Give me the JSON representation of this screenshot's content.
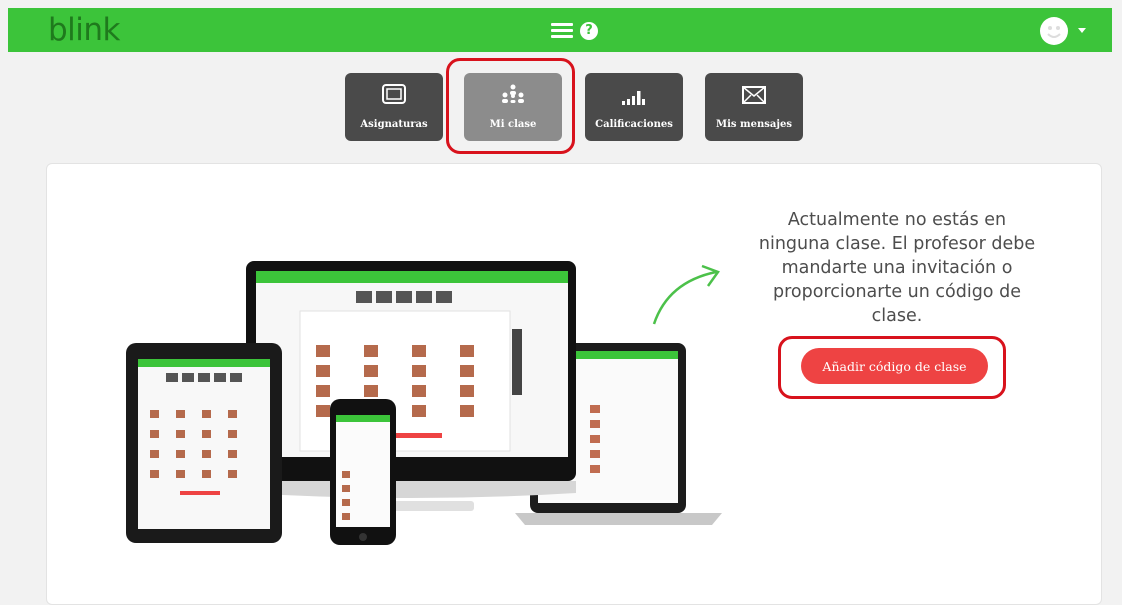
{
  "topbar": {
    "logo": "blink",
    "accent": "#3cc43a"
  },
  "nav": [
    {
      "label": "Asignaturas",
      "icon": "subjects-icon"
    },
    {
      "label": "Mi clase",
      "icon": "class-people-icon",
      "active": true
    },
    {
      "label": "Calificaciones",
      "icon": "grades-bars-icon"
    },
    {
      "label": "Mis mensajes",
      "icon": "envelope-icon"
    }
  ],
  "main": {
    "message": "Actualmente no estás en ninguna clase. El profesor debe mandarte una invitación o proporcionarte un código de clase.",
    "add_button": "Añadir código de clase",
    "button_color": "#ee4343",
    "highlight_color": "#d8121c"
  }
}
